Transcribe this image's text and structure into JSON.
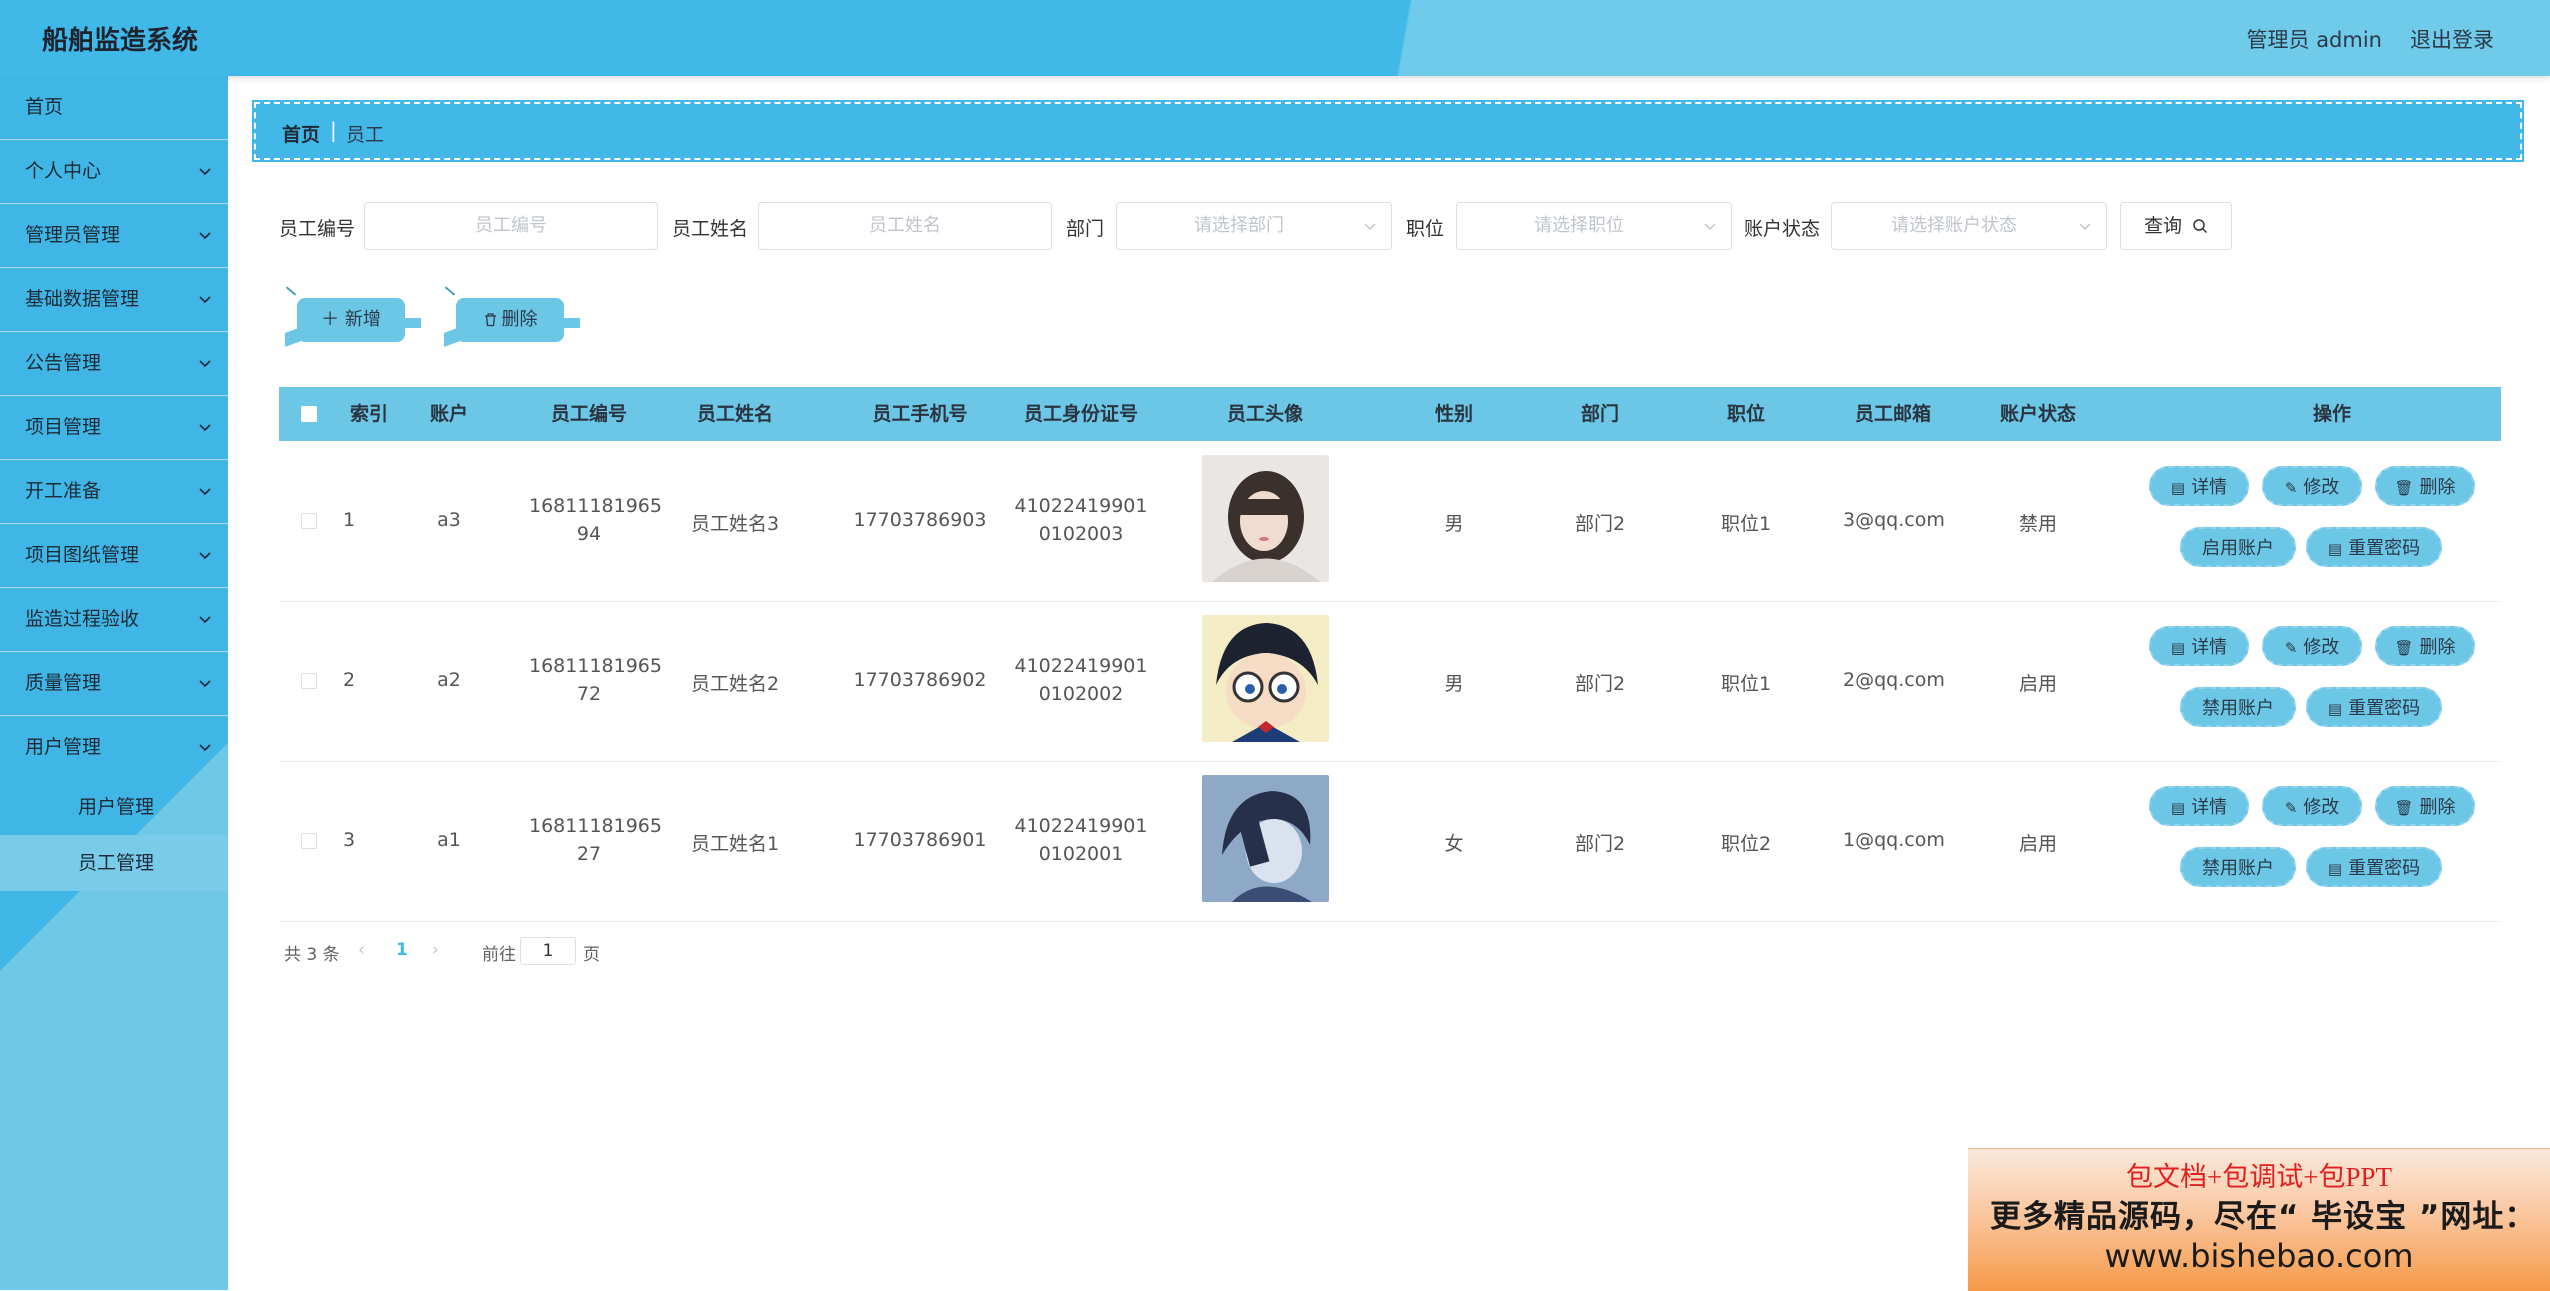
{
  "header": {
    "title": "船舶监造系统",
    "user": "管理员 admin",
    "logout": "退出登录"
  },
  "sidebar": {
    "items": [
      {
        "label": "首页",
        "expandable": false
      },
      {
        "label": "个人中心",
        "expandable": true
      },
      {
        "label": "管理员管理",
        "expandable": true
      },
      {
        "label": "基础数据管理",
        "expandable": true
      },
      {
        "label": "公告管理",
        "expandable": true
      },
      {
        "label": "项目管理",
        "expandable": true
      },
      {
        "label": "开工准备",
        "expandable": true
      },
      {
        "label": "项目图纸管理",
        "expandable": true
      },
      {
        "label": "监造过程验收",
        "expandable": true
      },
      {
        "label": "质量管理",
        "expandable": true
      },
      {
        "label": "用户管理",
        "expandable": true
      }
    ],
    "subitems": [
      {
        "label": "用户管理",
        "active": false
      },
      {
        "label": "员工管理",
        "active": true
      }
    ]
  },
  "breadcrumb": {
    "home": "首页",
    "sep": "|",
    "current": "员工"
  },
  "search": {
    "emp_no_label": "员工编号",
    "emp_no_placeholder": "员工编号",
    "emp_name_label": "员工姓名",
    "emp_name_placeholder": "员工姓名",
    "dept_label": "部门",
    "dept_placeholder": "请选择部门",
    "position_label": "职位",
    "position_placeholder": "请选择职位",
    "status_label": "账户状态",
    "status_placeholder": "请选择账户状态",
    "query_label": "查询"
  },
  "actions": {
    "add_label": "新增",
    "delete_label": "删除"
  },
  "table": {
    "columns": [
      "索引",
      "账户",
      "员工编号",
      "员工姓名",
      "员工手机号",
      "员工身份证号",
      "员工头像",
      "性别",
      "部门",
      "职位",
      "员工邮箱",
      "账户状态",
      "操作"
    ],
    "rows": [
      {
        "index": "1",
        "account": "a3",
        "emp_no_1": "16811181965",
        "emp_no_2": "94",
        "name": "员工姓名3",
        "phone": "17703786903",
        "id_1": "41022419901",
        "id_2": "0102003",
        "gender": "男",
        "dept": "部门2",
        "position": "职位1",
        "email": "3@qq.com",
        "status": "禁用",
        "toggle": "启用账户",
        "avatar": "avatar-girl"
      },
      {
        "index": "2",
        "account": "a2",
        "emp_no_1": "16811181965",
        "emp_no_2": "72",
        "name": "员工姓名2",
        "phone": "17703786902",
        "id_1": "41022419901",
        "id_2": "0102002",
        "gender": "男",
        "dept": "部门2",
        "position": "职位1",
        "email": "2@qq.com",
        "status": "启用",
        "toggle": "禁用账户",
        "avatar": "avatar-anime-boy"
      },
      {
        "index": "3",
        "account": "a1",
        "emp_no_1": "16811181965",
        "emp_no_2": "27",
        "name": "员工姓名1",
        "phone": "17703786901",
        "id_1": "41022419901",
        "id_2": "0102001",
        "gender": "女",
        "dept": "部门2",
        "position": "职位2",
        "email": "1@qq.com",
        "status": "启用",
        "toggle": "禁用账户",
        "avatar": "avatar-anime-blue"
      }
    ],
    "ops": {
      "detail": "详情",
      "edit": "修改",
      "delete": "删除",
      "reset": "重置密码"
    }
  },
  "pager": {
    "total": "共 3 条",
    "prev": "‹",
    "page": "1",
    "next": "›",
    "goto": "前往",
    "goto_value": "1",
    "page_suffix": "页"
  },
  "ad": {
    "line1": "包文档+包调试+包PPT",
    "line2": "更多精品源码，尽在“ 毕设宝 ”网址：",
    "line3": "www.bishebao.com"
  },
  "colors": {
    "primary": "#41b8e8",
    "button": "#6cc6e6",
    "sidebar": "#3fb6e6"
  }
}
